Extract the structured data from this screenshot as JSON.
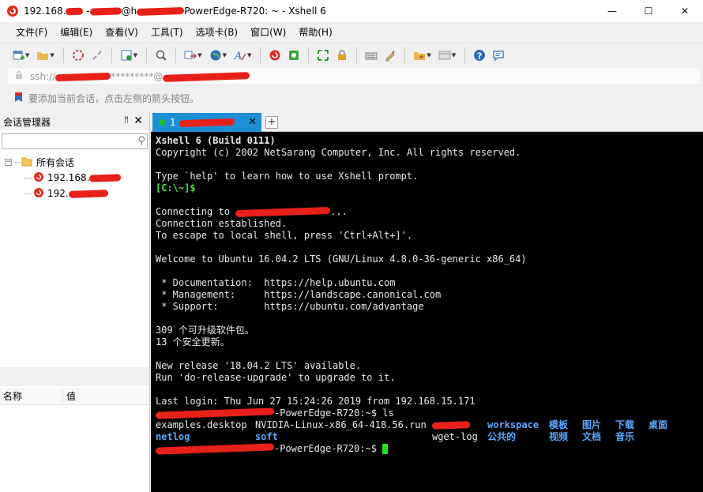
{
  "window": {
    "title_prefix": "192.168.",
    "title_mid": "@h",
    "title_suffix": "PowerEdge-R720: ~ - Xshell 6",
    "minimize": "—",
    "maximize": "☐",
    "close": "✕"
  },
  "menu": [
    "文件(F)",
    "编辑(E)",
    "查看(V)",
    "工具(T)",
    "选项卡(B)",
    "窗口(W)",
    "帮助(H)"
  ],
  "address": {
    "prefix": "ssh://",
    "mid": "*********@"
  },
  "hint": "要添加当前会话，点击左侧的箭头按钮。",
  "session_manager": {
    "title": "会话管理器",
    "pin": "ᛗ",
    "close": "✕",
    "search_placeholder": "",
    "root": "所有会话",
    "items": [
      "192.168.",
      "192."
    ],
    "columns": {
      "name": "名称",
      "value": "值"
    }
  },
  "tabs": [
    {
      "label": "1"
    }
  ],
  "tab_add": "+",
  "terminal": {
    "header": "Xshell 6 (Build 0111)",
    "copyright": "Copyright (c) 2002 NetSarang Computer, Inc. All rights reserved.",
    "help": "Type `help' to learn how to use Xshell prompt.",
    "local_prompt": "[C:\\~]$",
    "connecting": "Connecting to",
    "connecting_tail": "...",
    "established": "Connection established.",
    "escape": "To escape to local shell, press 'Ctrl+Alt+]'.",
    "welcome": "Welcome to Ubuntu 16.04.2 LTS (GNU/Linux 4.8.0-36-generic x86_64)",
    "doc": " * Documentation:  https://help.ubuntu.com",
    "mgmt": " * Management:     https://landscape.canonical.com",
    "support": " * Support:        https://ubuntu.com/advantage",
    "upgradable": "309 个可升级软件包。",
    "security": "13 个安全更新。",
    "release": "New release '18.04.2 LTS' available.",
    "release_hint": "Run 'do-release-upgrade' to upgrade to it.",
    "last_login": "Last login: Thu Jun 27 15:24:26 2019 from 192.168.15.171",
    "prompt_tail": "-PowerEdge-R720:~$ ls",
    "prompt_tail2": "-PowerEdge-R720:~$ ",
    "ls_row1": {
      "f1": "examples.desktop",
      "f2": "NVIDIA-Linux-x86_64-418.56.run",
      "d1": "workspace",
      "d2": "模板",
      "d3": "图片",
      "d4": "下载",
      "d5": "桌面"
    },
    "ls_row2": {
      "d1": "netlog",
      "d2": "soft",
      "f1": "wget-log",
      "d3": "公共的",
      "d4": "视频",
      "d5": "文档",
      "d6": "音乐"
    }
  },
  "colors": {
    "tab_active": "#1d8fd6",
    "prompt_green": "#46e646",
    "dir_blue": "#5aa8ff",
    "redaction": "#e8201a"
  }
}
